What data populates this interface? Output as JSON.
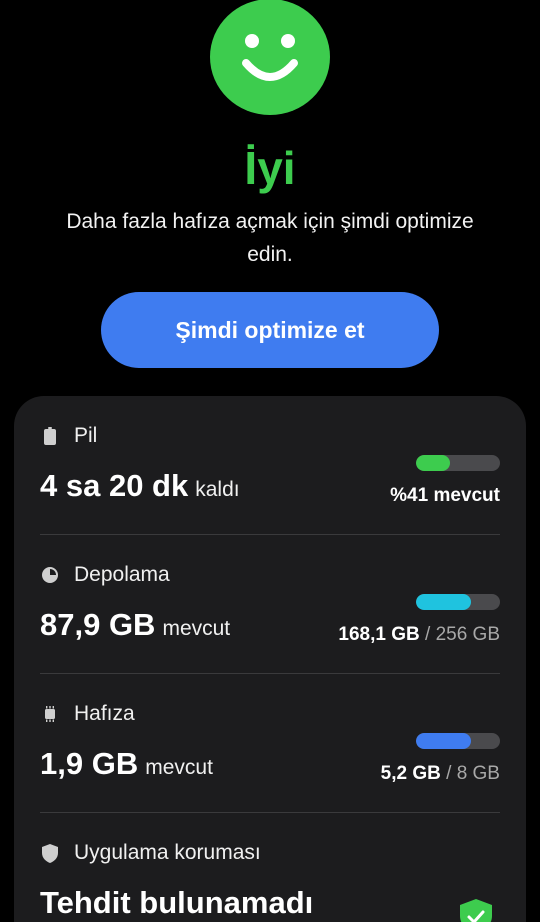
{
  "status": {
    "face_icon": "smiley-face-icon",
    "label": "İyi",
    "message": "Daha fazla hafıza açmak için şimdi optimize edin.",
    "color": "#3dcc4e"
  },
  "optimize_button": {
    "label": "Şimdi optimize et",
    "color": "#3f7cf0"
  },
  "battery": {
    "icon": "battery-icon",
    "title": "Pil",
    "value": "4 sa 20 dk",
    "unit": "kaldı",
    "available_text": "%41 mevcut",
    "level": 0.41,
    "bar_color": "#3dcc4e"
  },
  "storage": {
    "icon": "pie-chart-icon",
    "title": "Depolama",
    "value": "87,9 GB",
    "unit": "mevcut",
    "used": "168,1 GB",
    "separator": "/",
    "total": "256 GB",
    "level": 0.66,
    "bar_color": "#1fc3df"
  },
  "memory": {
    "icon": "memory-chip-icon",
    "title": "Hafıza",
    "value": "1,9 GB",
    "unit": "mevcut",
    "used": "5,2 GB",
    "separator": "/",
    "total": "8 GB",
    "level": 0.65,
    "bar_color": "#3f7cf0"
  },
  "app_protection": {
    "icon": "shield-icon",
    "title": "Uygulama koruması",
    "value": "Tehdit bulunamadı",
    "badge_icon": "shield-check-icon",
    "badge_color": "#3dcc4e"
  }
}
